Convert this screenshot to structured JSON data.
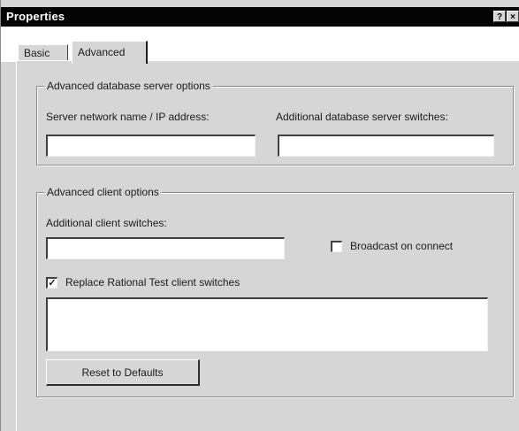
{
  "window": {
    "title": "Properties",
    "help_label": "?",
    "close_label": "×"
  },
  "tabs": [
    {
      "label": "Basic",
      "selected": false
    },
    {
      "label": "Advanced",
      "selected": true
    }
  ],
  "db_group": {
    "legend": "Advanced database server options",
    "server_label": "Server network name / IP address:",
    "server_value": "",
    "switches_label": "Additional database server switches:",
    "switches_value": ""
  },
  "client_group": {
    "legend": "Advanced client options",
    "switches_label": "Additional client switches:",
    "switches_value": "",
    "broadcast_label": "Broadcast on connect",
    "broadcast_checked": false,
    "replace_label": "Replace Rational Test client switches",
    "replace_checked": true,
    "replace_text": "",
    "reset_label": "Reset to Defaults"
  },
  "glyphs": {
    "check_mark": "✓"
  },
  "colors": {
    "face": "#d6d6d6",
    "title_bar": "#050505"
  }
}
